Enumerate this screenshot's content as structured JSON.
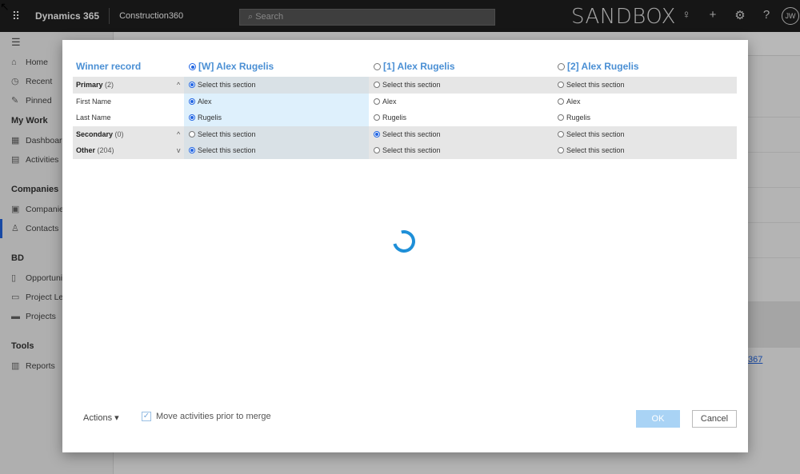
{
  "topbar": {
    "app_name": "Dynamics 365",
    "module": "Construction360",
    "search_placeholder": "Search",
    "environment": "SANDBOX",
    "user_initials": "JW"
  },
  "sidebar": {
    "items": [
      {
        "label": "Home",
        "icon": "home-icon"
      },
      {
        "label": "Recent",
        "icon": "clock-icon"
      },
      {
        "label": "Pinned",
        "icon": "pin-icon"
      }
    ],
    "group_mywork": "My Work",
    "mywork_items": [
      {
        "label": "Dashboards",
        "icon": "dashboard-icon"
      },
      {
        "label": "Activities",
        "icon": "clipboard-icon"
      }
    ],
    "group_companies": "Companies",
    "companies_items": [
      {
        "label": "Companies",
        "icon": "building-icon"
      },
      {
        "label": "Contacts",
        "icon": "person-icon"
      }
    ],
    "group_bd": "BD",
    "bd_items": [
      {
        "label": "Opportunities",
        "icon": "document-icon"
      },
      {
        "label": "Project Leads",
        "icon": "lead-icon"
      },
      {
        "label": "Projects",
        "icon": "project-icon"
      }
    ],
    "group_tools": "Tools",
    "tools_items": [
      {
        "label": "Reports",
        "icon": "report-icon"
      }
    ]
  },
  "background": {
    "link_text": "367"
  },
  "merge_dialog": {
    "headers": {
      "winner": "Winner record",
      "col_w": "[W] Alex Rugelis",
      "col_1": "[1] Alex Rugelis",
      "col_2": "[2] Alex Rugelis"
    },
    "select_section_label": "Select this section",
    "sections": {
      "primary": {
        "label": "Primary",
        "count": "(2)"
      },
      "secondary": {
        "label": "Secondary",
        "count": "(0)"
      },
      "other": {
        "label": "Other",
        "count": "(204)"
      }
    },
    "fields": {
      "first_name": {
        "label": "First Name",
        "w": "Alex",
        "r1": "Alex",
        "r2": "Alex"
      },
      "last_name": {
        "label": "Last Name",
        "w": "Rugelis",
        "r1": "Rugelis",
        "r2": "Rugelis"
      }
    },
    "footer": {
      "actions_label": "Actions",
      "move_activities_label": "Move activities prior to merge",
      "move_activities_checked": true,
      "ok_label": "OK",
      "cancel_label": "Cancel"
    }
  }
}
